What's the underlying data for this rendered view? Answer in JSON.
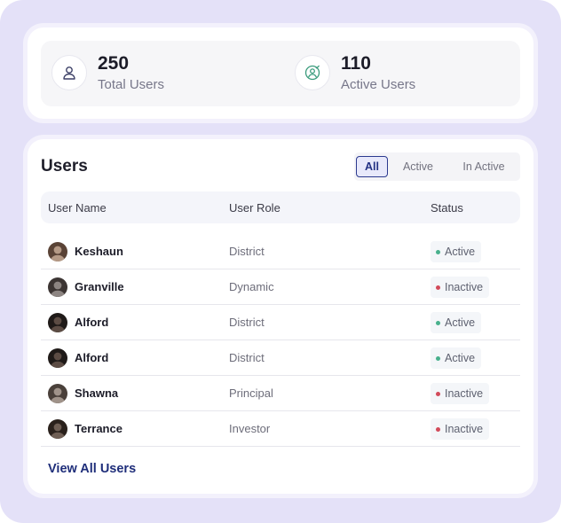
{
  "stats": {
    "total": {
      "value": "250",
      "label": "Total Users",
      "icon": "user-icon"
    },
    "active": {
      "value": "110",
      "label": "Active Users",
      "icon": "active-user-icon"
    }
  },
  "users": {
    "title": "Users",
    "tabs": [
      {
        "label": "All",
        "selected": true
      },
      {
        "label": "Active",
        "selected": false
      },
      {
        "label": "In Active",
        "selected": false
      }
    ],
    "columns": [
      "User Name",
      "User Role",
      "Status"
    ],
    "rows": [
      {
        "name": "Keshaun",
        "role": "District",
        "status": "Active"
      },
      {
        "name": "Granville",
        "role": "Dynamic",
        "status": "Inactive"
      },
      {
        "name": "Alford",
        "role": "District",
        "status": "Active"
      },
      {
        "name": "Alford",
        "role": "District",
        "status": "Active"
      },
      {
        "name": "Shawna",
        "role": "Principal",
        "status": "Inactive"
      },
      {
        "name": "Terrance",
        "role": "Investor",
        "status": "Inactive"
      }
    ],
    "view_all": "View All Users"
  },
  "colors": {
    "active_dot": "#48b08c",
    "inactive_dot": "#d24a5a",
    "accent": "#233184",
    "stat_active_icon": "#3a9b7c",
    "stat_total_icon": "#3b3f66"
  }
}
